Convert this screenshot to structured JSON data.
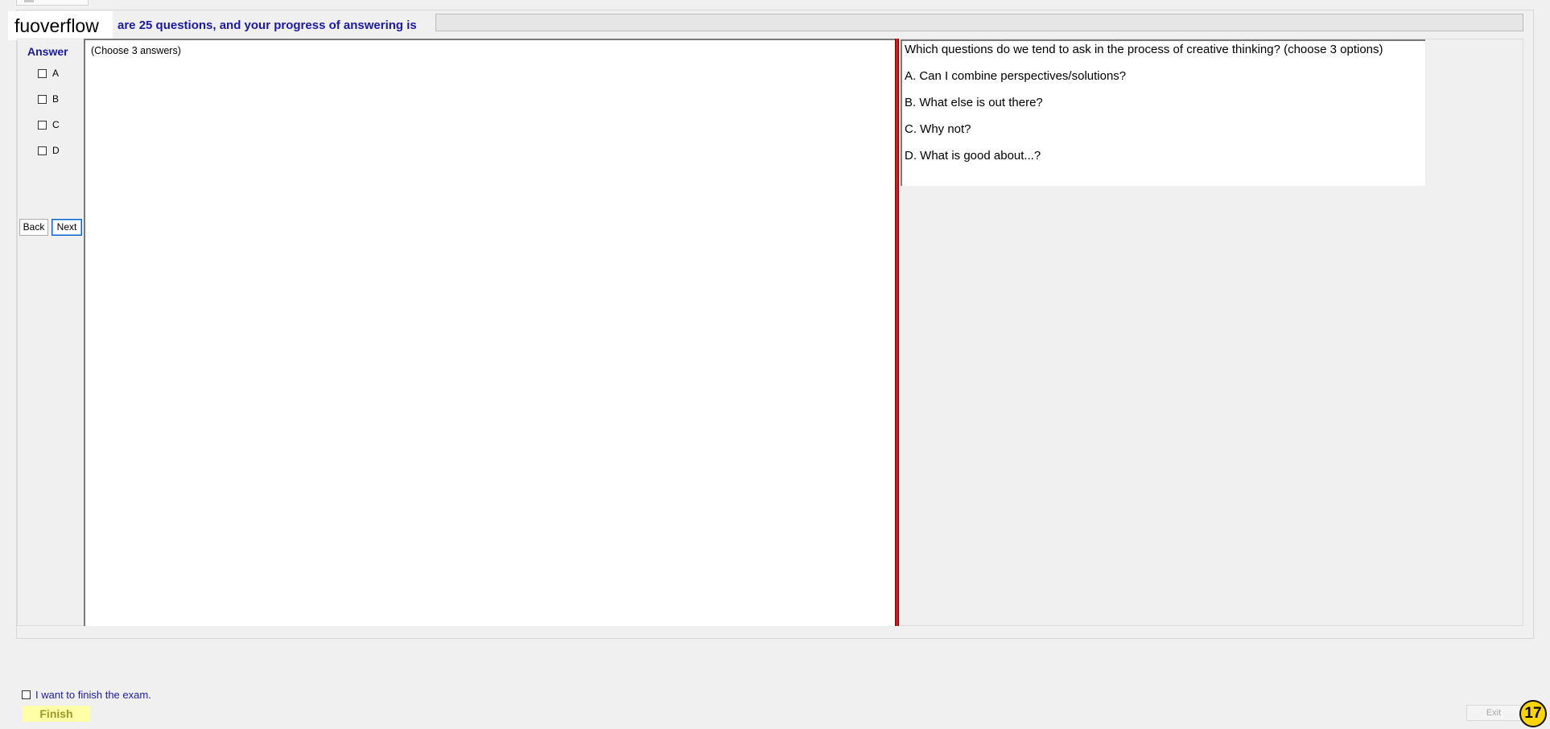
{
  "logo": {
    "text": "fuoverflow"
  },
  "header": {
    "progress_label": "are 25 questions, and your progress of answering is",
    "progress_fraction": 0
  },
  "answer_panel": {
    "heading": "Answer",
    "choices": [
      {
        "label": "A",
        "checked": false
      },
      {
        "label": "B",
        "checked": false
      },
      {
        "label": "C",
        "checked": false
      },
      {
        "label": "D",
        "checked": false
      }
    ],
    "back_label": "Back",
    "next_label": "Next"
  },
  "answer_area": {
    "instruction": "(Choose 3 answers)"
  },
  "question": {
    "text": "Which questions do we tend to ask in the process of creative thinking? (choose 3 options)",
    "options": [
      "A.  Can I combine perspectives/solutions?",
      "B.  What else is out there?",
      "C.  Why not?",
      "D.  What is good about...?"
    ]
  },
  "footer": {
    "finish_checkbox_label": "I want to finish the exam.",
    "finish_label": "Finish",
    "exit_label": "Exit",
    "badge": "17"
  },
  "colors": {
    "accent_blue": "#1a1aa6",
    "splitter_red": "#d9161c",
    "finish_yellow": "#ffffa8",
    "badge_yellow": "#ffd400"
  }
}
